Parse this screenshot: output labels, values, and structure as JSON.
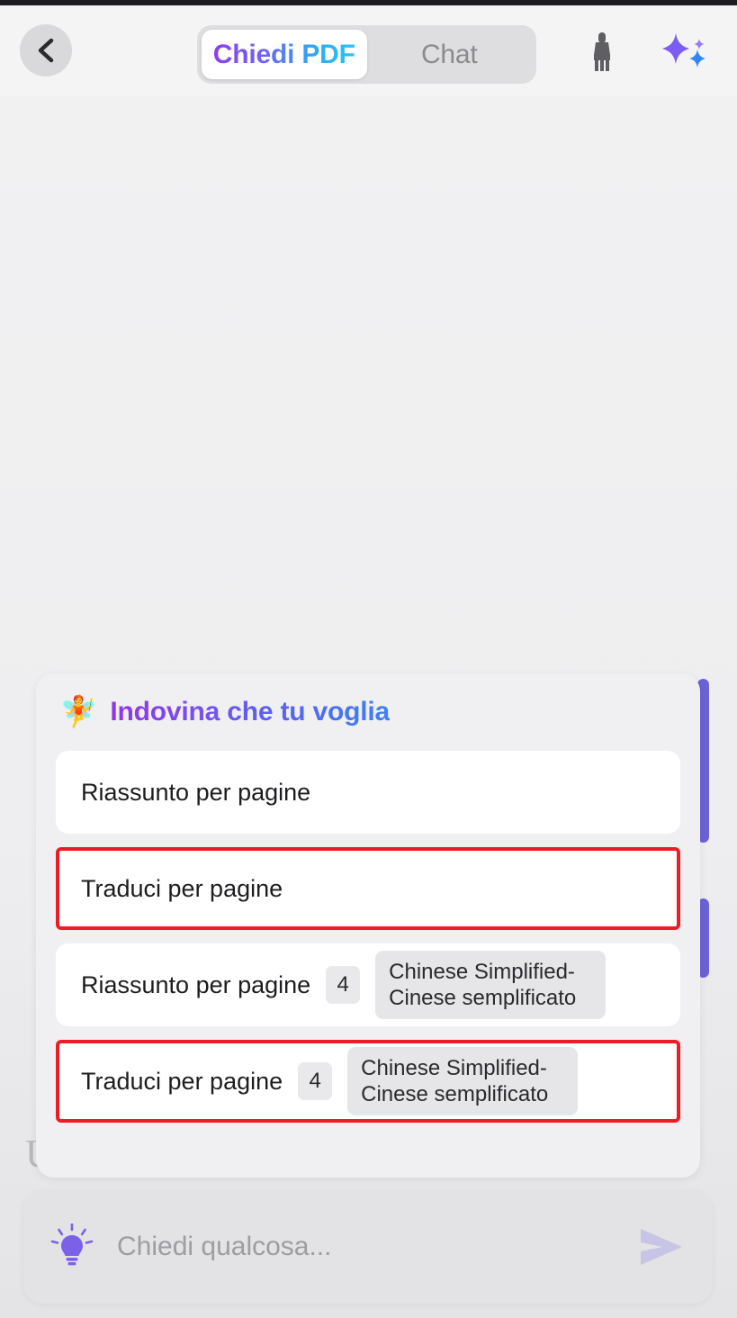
{
  "header": {
    "back_icon": "chevron-left-icon",
    "segments": [
      {
        "label": "Chiedi PDF",
        "active": true
      },
      {
        "label": "Chat",
        "active": false
      }
    ],
    "actions": [
      {
        "name": "brush-icon",
        "color": "#5e5e63"
      },
      {
        "name": "sparkles-icon",
        "color": "#7c5cf5"
      }
    ]
  },
  "canvas": {
    "ghost_glyph": "U"
  },
  "suggestions": {
    "title": "Indovina che tu voglia",
    "title_icon": "🧚",
    "title_gradient_from": "#9333ea",
    "title_gradient_to": "#3b82f6",
    "highlight_color": "#ee1c25",
    "items": [
      {
        "text": "Riassunto per pagine",
        "count": null,
        "language": null,
        "highlighted": false
      },
      {
        "text": "Traduci per pagine",
        "count": null,
        "language": null,
        "highlighted": true
      },
      {
        "text": "Riassunto per pagine",
        "count": "4",
        "language": "Chinese Simplified-Cinese semplificato",
        "highlighted": false
      },
      {
        "text": "Traduci per pagine",
        "count": "4",
        "language": "Chinese Simplified-Cinese semplificato",
        "highlighted": true
      }
    ]
  },
  "input": {
    "bulb_icon": "lightbulb-icon",
    "placeholder": "Chiedi qualcosa...",
    "send_icon": "send-icon",
    "send_color": "#c8c4e6"
  }
}
